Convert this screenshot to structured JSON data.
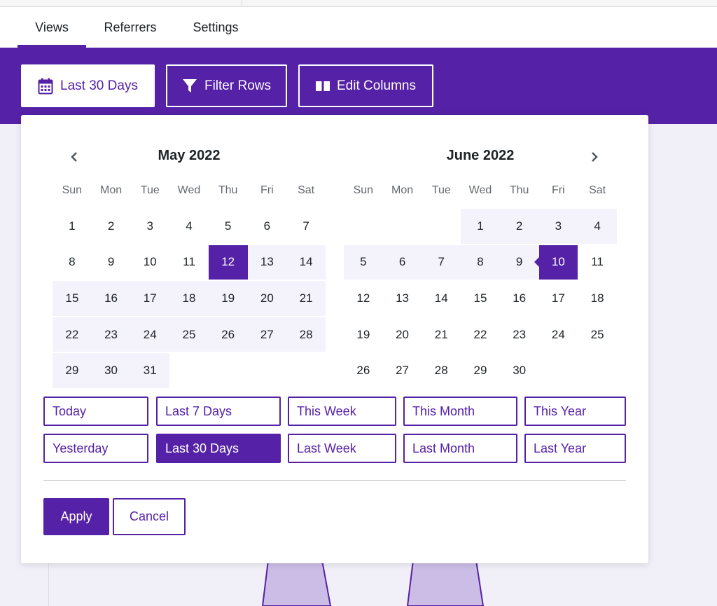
{
  "tabs": [
    {
      "label": "Views",
      "active": true
    },
    {
      "label": "Referrers",
      "active": false
    },
    {
      "label": "Settings",
      "active": false
    }
  ],
  "toolbar": {
    "date_range_label": "Last 30 Days",
    "filter_label": "Filter Rows",
    "columns_label": "Edit Columns"
  },
  "calendar": {
    "left_month": "May 2022",
    "right_month": "June 2022",
    "weekdays": [
      "Sun",
      "Mon",
      "Tue",
      "Wed",
      "Thu",
      "Fri",
      "Sat"
    ],
    "selected_start": "May 12, 2022",
    "selected_end": "June 10, 2022",
    "may_days": [
      "1",
      "2",
      "3",
      "4",
      "5",
      "6",
      "7",
      "8",
      "9",
      "10",
      "11",
      "12",
      "13",
      "14",
      "15",
      "16",
      "17",
      "18",
      "19",
      "20",
      "21",
      "22",
      "23",
      "24",
      "25",
      "26",
      "27",
      "28",
      "29",
      "30",
      "31"
    ],
    "june_days": [
      "1",
      "2",
      "3",
      "4",
      "5",
      "6",
      "7",
      "8",
      "9",
      "10",
      "11",
      "12",
      "13",
      "14",
      "15",
      "16",
      "17",
      "18",
      "19",
      "20",
      "21",
      "22",
      "23",
      "24",
      "25",
      "26",
      "27",
      "28",
      "29",
      "30"
    ]
  },
  "presets": [
    {
      "label": "Today",
      "active": false
    },
    {
      "label": "Last 7 Days",
      "active": false
    },
    {
      "label": "This Week",
      "active": false
    },
    {
      "label": "This Month",
      "active": false
    },
    {
      "label": "This Year",
      "active": false
    },
    {
      "label": "Yesterday",
      "active": false
    },
    {
      "label": "Last 30 Days",
      "active": true
    },
    {
      "label": "Last Week",
      "active": false
    },
    {
      "label": "Last Month",
      "active": false
    },
    {
      "label": "Last Year",
      "active": false
    }
  ],
  "actions": {
    "apply_label": "Apply",
    "cancel_label": "Cancel"
  },
  "colors": {
    "accent": "#5521a6",
    "range_bg": "#f4f2fb",
    "chart_fill": "#cbbde6"
  }
}
